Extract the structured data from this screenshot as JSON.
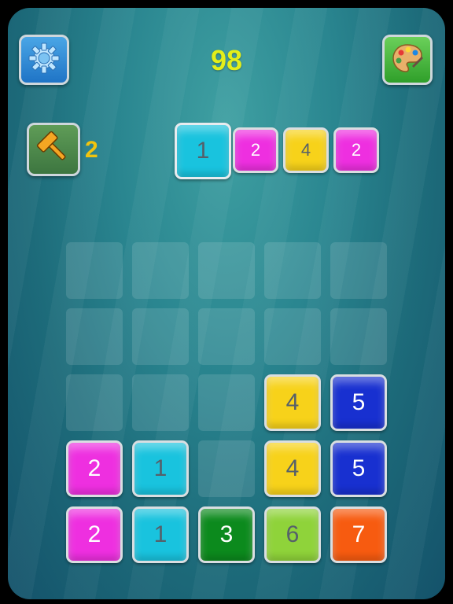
{
  "score": "98",
  "hammer": {
    "count": "2",
    "icon": "hammer-icon"
  },
  "buttons": {
    "settings_icon": "gear-icon",
    "palette_icon": "palette-icon"
  },
  "colors": {
    "1": "#19c3de",
    "2": "#ee2fe0",
    "3": "#0c8a1d",
    "4": "#f7d21a",
    "5": "#1830d0",
    "6": "#8fd33a",
    "7": "#f75b10"
  },
  "queue": [
    "1",
    "2",
    "4",
    "2"
  ],
  "board": [
    [
      "",
      "",
      "",
      "",
      ""
    ],
    [
      "",
      "",
      "",
      "",
      ""
    ],
    [
      "",
      "",
      "",
      "4",
      "5"
    ],
    [
      "2",
      "1",
      "",
      "4",
      "5"
    ],
    [
      "2",
      "1",
      "3",
      "6",
      "7"
    ]
  ]
}
